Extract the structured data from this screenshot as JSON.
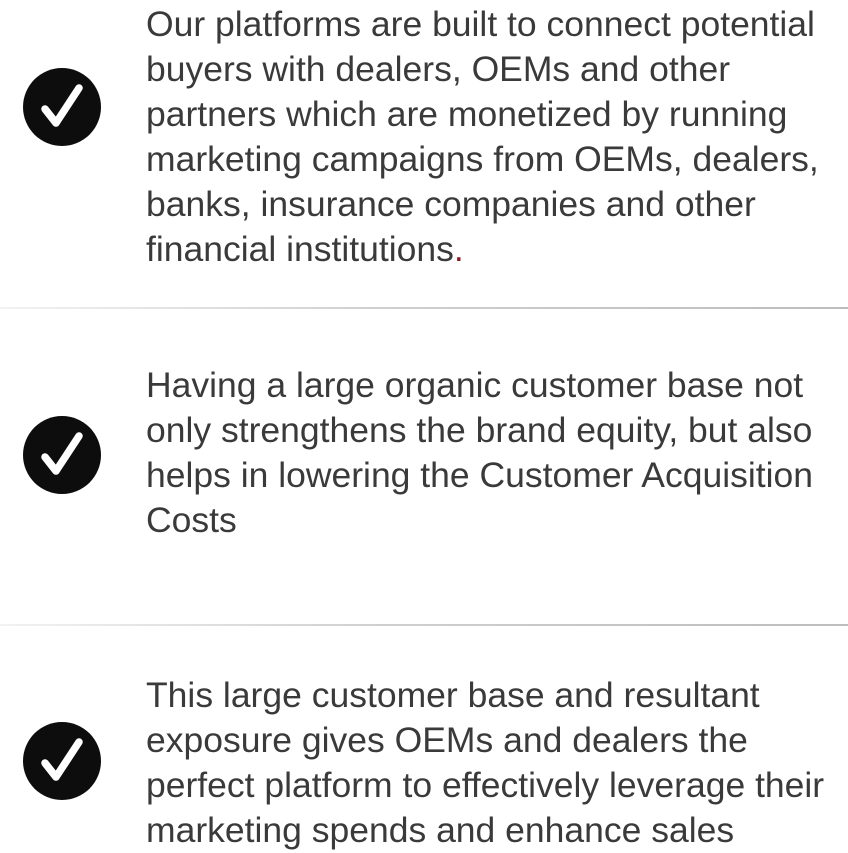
{
  "items": [
    {
      "text": "Our platforms are built to connect potential\nbuyers with dealers, OEMs and other\npartners which  are monetized by running\nmarketing campaigns from OEMs, dealers,\nbanks, insurance companies and other\nfinancial institutions",
      "suffix": ".",
      "icon": "check-circle-icon"
    },
    {
      "text": "Having a large organic customer base not\nonly strengthens the brand equity, but also\nhelps in lowering the Customer Acquisition\nCosts",
      "icon": "check-circle-icon"
    },
    {
      "text": "This large customer base and resultant\nexposure gives OEMs and dealers the\nperfect platform to effectively leverage their\nmarketing spends and enhance sales",
      "icon": "check-circle-icon"
    }
  ],
  "colors": {
    "text": "#3a3a3a",
    "icon_bg": "#0d0d0d",
    "icon_check": "#ffffff",
    "accent": "#8b1a2b",
    "divider": "#cfcfcf"
  }
}
